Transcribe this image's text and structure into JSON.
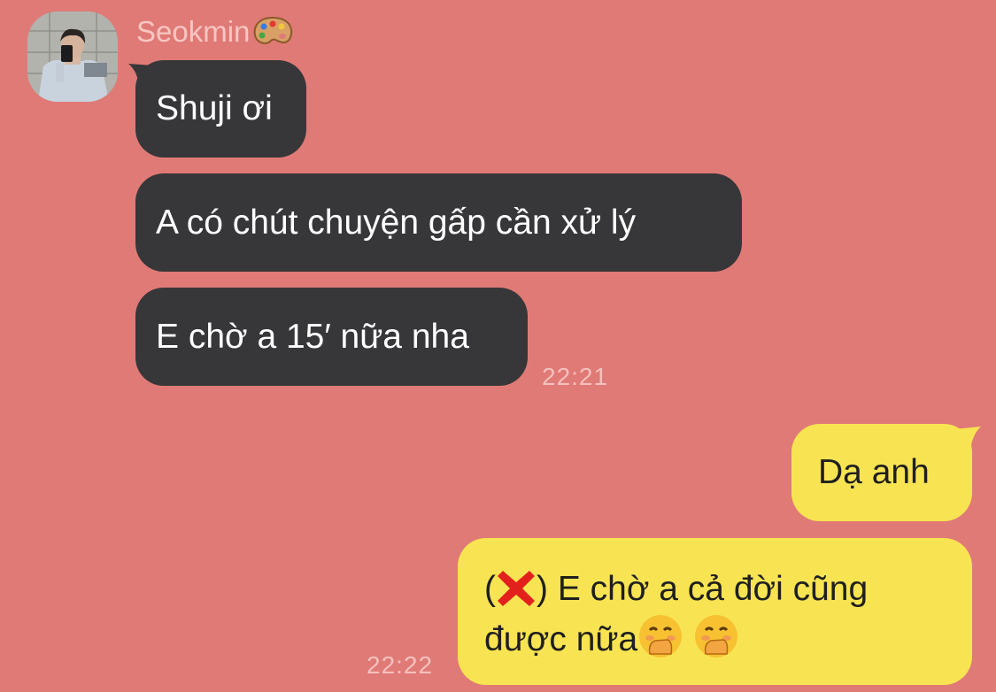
{
  "sender": {
    "name": "Seokmin",
    "name_emoji": "palette-icon"
  },
  "incoming": [
    {
      "text": "Shuji ơi"
    },
    {
      "text": "A có chút chuyện gấp cần xử lý"
    },
    {
      "text": "E chờ a 15′ nữa nha"
    }
  ],
  "incoming_time": "22:21",
  "outgoing": [
    {
      "text": "Dạ anh"
    },
    {
      "prefix": "(",
      "icon": "cross-mark-icon",
      "line1": ") E chờ a cả đời cũng",
      "line2": "được nữa",
      "emojis": [
        "hand-over-mouth-emoji",
        "hand-over-mouth-emoji"
      ]
    }
  ],
  "outgoing_time": "22:22",
  "colors": {
    "background": "#e07a76",
    "incoming_bubble": "#373639",
    "outgoing_bubble": "#f8e452"
  }
}
